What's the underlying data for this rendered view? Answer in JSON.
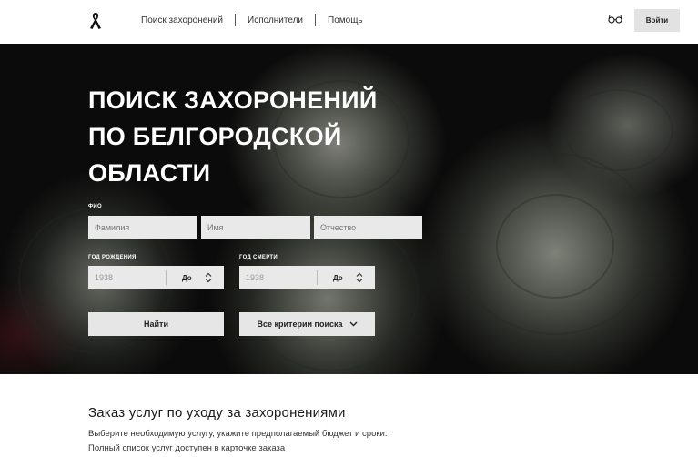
{
  "header": {
    "logo_icon": "ribbon-icon",
    "nav": [
      {
        "label": "Поиск захоронений"
      },
      {
        "label": "Исполнители"
      },
      {
        "label": "Помощь"
      }
    ],
    "accessibility_icon": "glasses-icon",
    "login_label": "Войти"
  },
  "hero": {
    "title_lines": [
      "ПОИСК ЗАХОРОНЕНИЙ",
      "ПО БЕЛГОРОДСКОЙ",
      "ОБЛАСТИ"
    ],
    "fio_label": "ФИО",
    "surname_placeholder": "Фамилия",
    "name_placeholder": "Имя",
    "patronymic_placeholder": "Отчество",
    "birth_label": "ГОД РОЖДЕНИЯ",
    "death_label": "ГОД СМЕРТИ",
    "birth_from": "1938",
    "birth_to": "До",
    "death_from": "1938",
    "death_to": "До",
    "search_button": "Найти",
    "all_criteria_button": "Все критерии поиска"
  },
  "services": {
    "heading": "Заказ услуг по уходу за захоронениями",
    "line1": "Выберите необходимую услугу, укажите предполагаемый бюджет и сроки.",
    "line2": "Полный список услуг доступен в карточке заказа"
  },
  "colors": {
    "hero_bg": "#121312",
    "input_bg": "#e9e9e9",
    "button_bg": "#e6e6e6"
  }
}
